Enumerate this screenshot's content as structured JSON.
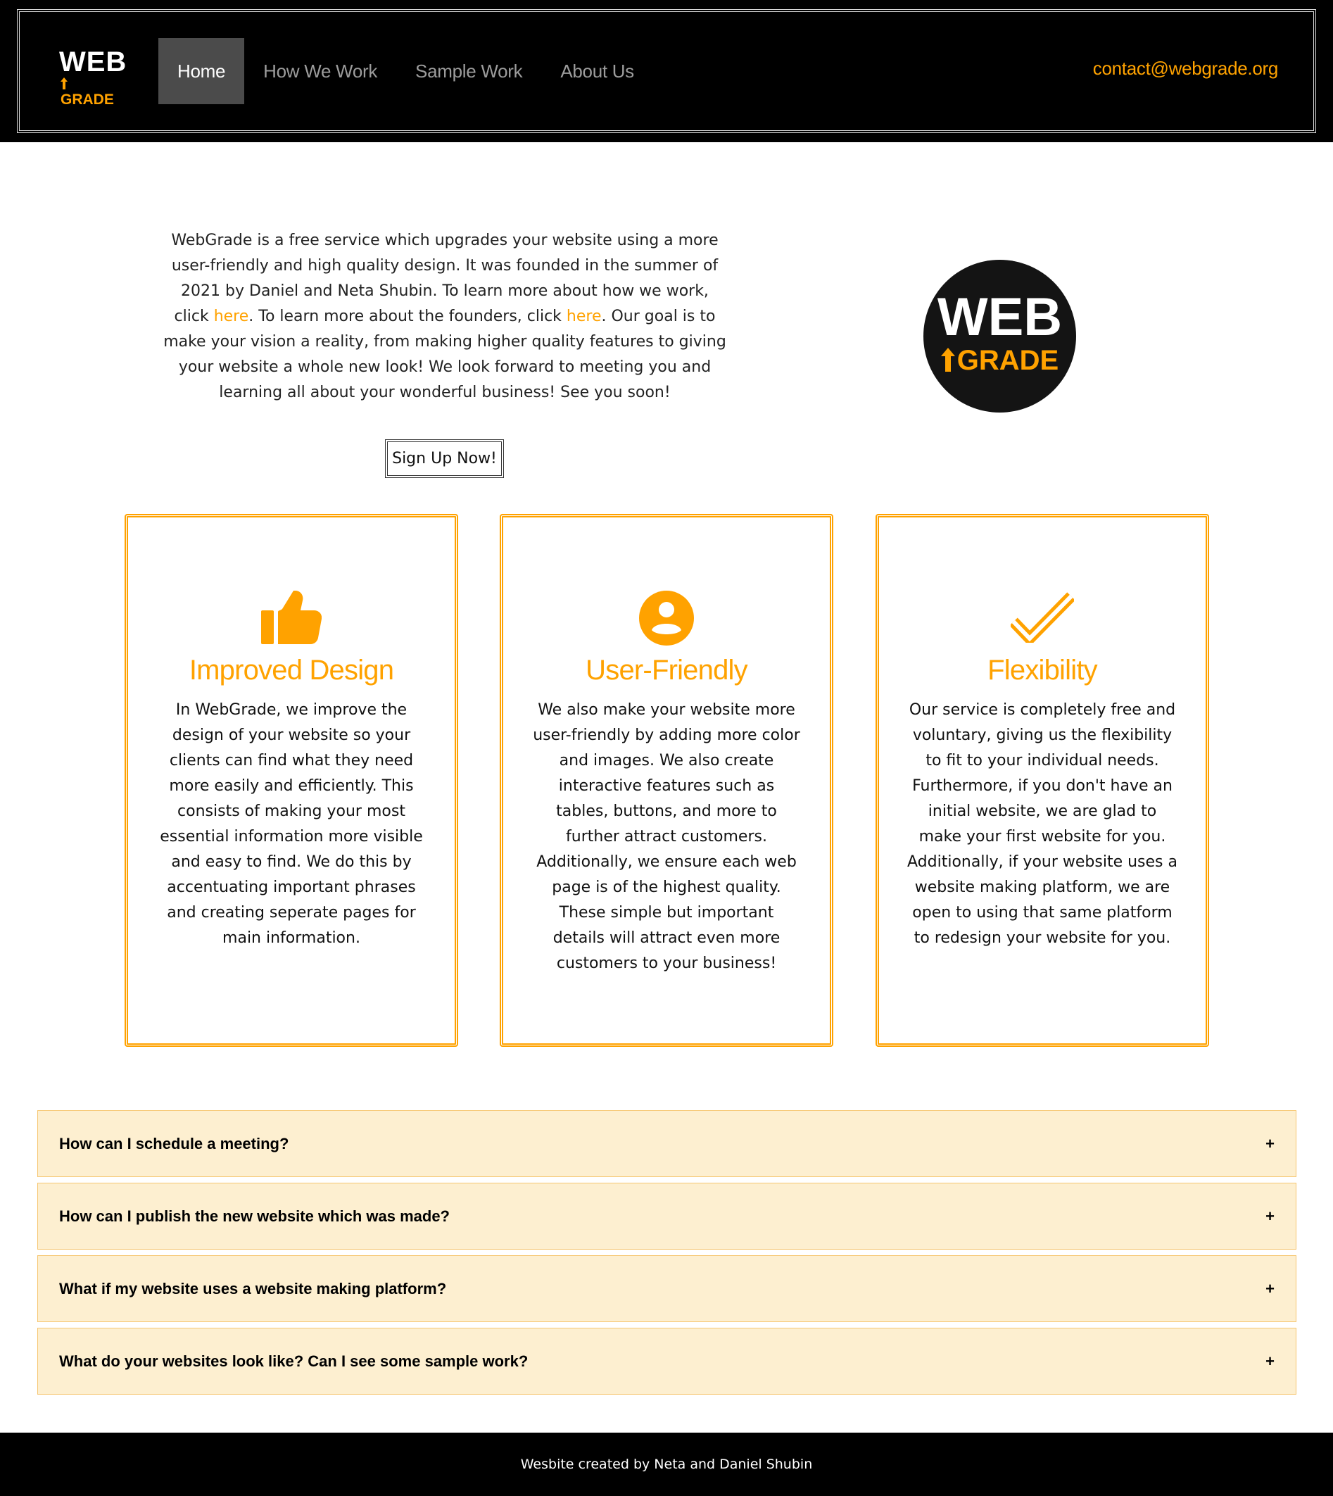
{
  "header": {
    "logo": {
      "top": "WEB",
      "bottom": "GRADE"
    },
    "nav": [
      {
        "label": "Home",
        "active": true
      },
      {
        "label": "How We Work",
        "active": false
      },
      {
        "label": "Sample Work",
        "active": false
      },
      {
        "label": "About Us",
        "active": false
      }
    ],
    "email": "contact@webgrade.org"
  },
  "intro": {
    "part1": "WebGrade is a free service which upgrades your website using a more user-friendly and high quality design. It was founded in the summer of 2021 by Daniel and Neta Shubin. To learn more about how we work, click ",
    "link1": "here",
    "part2": ". To learn more about the founders, click ",
    "link2": "here",
    "part3": ". Our goal is to make your vision a reality, from making higher quality features to giving your website a whole new look! We look forward to meeting you and learning all about your wonderful business! See you soon!",
    "signup_label": "Sign Up Now!"
  },
  "badge": {
    "top": "WEB",
    "bottom": "GRADE"
  },
  "features": [
    {
      "icon": "thumbs-up-icon",
      "title": "Improved Design",
      "text": "In WebGrade, we improve the design of your website so your clients can find what they need more easily and efficiently. This consists of making your most essential information more visible and easy to find. We do this by accentuating important phrases and creating seperate pages for main information."
    },
    {
      "icon": "user-circle-icon",
      "title": "User-Friendly",
      "text": "We also make your website more user-friendly by adding more color and images. We also create interactive features such as tables, buttons, and more to further attract customers. Additionally, we ensure each web page is of the highest quality. These simple but important details will attract even more customers to your business!"
    },
    {
      "icon": "checkmark-icon",
      "title": "Flexibility",
      "text": "Our service is completely free and voluntary, giving us the flexibility to fit to your individual needs. Furthermore, if you don't have an initial website, we are glad to make your first website for you. Additionally, if your website uses a website making platform, we are open to using that same platform to redesign your website for you."
    }
  ],
  "faq": [
    {
      "question": "How can I schedule a meeting?",
      "toggle": "+"
    },
    {
      "question": "How can I publish the new website which was made?",
      "toggle": "+"
    },
    {
      "question": "What if my website uses a website making platform?",
      "toggle": "+"
    },
    {
      "question": "What do your websites look like? Can I see some sample work?",
      "toggle": "+"
    }
  ],
  "footer": {
    "text": "Wesbite created by Neta and Daniel Shubin"
  },
  "colors": {
    "accent": "#ffa200",
    "faq_bg": "#fdefd0",
    "header_bg": "#000000"
  }
}
